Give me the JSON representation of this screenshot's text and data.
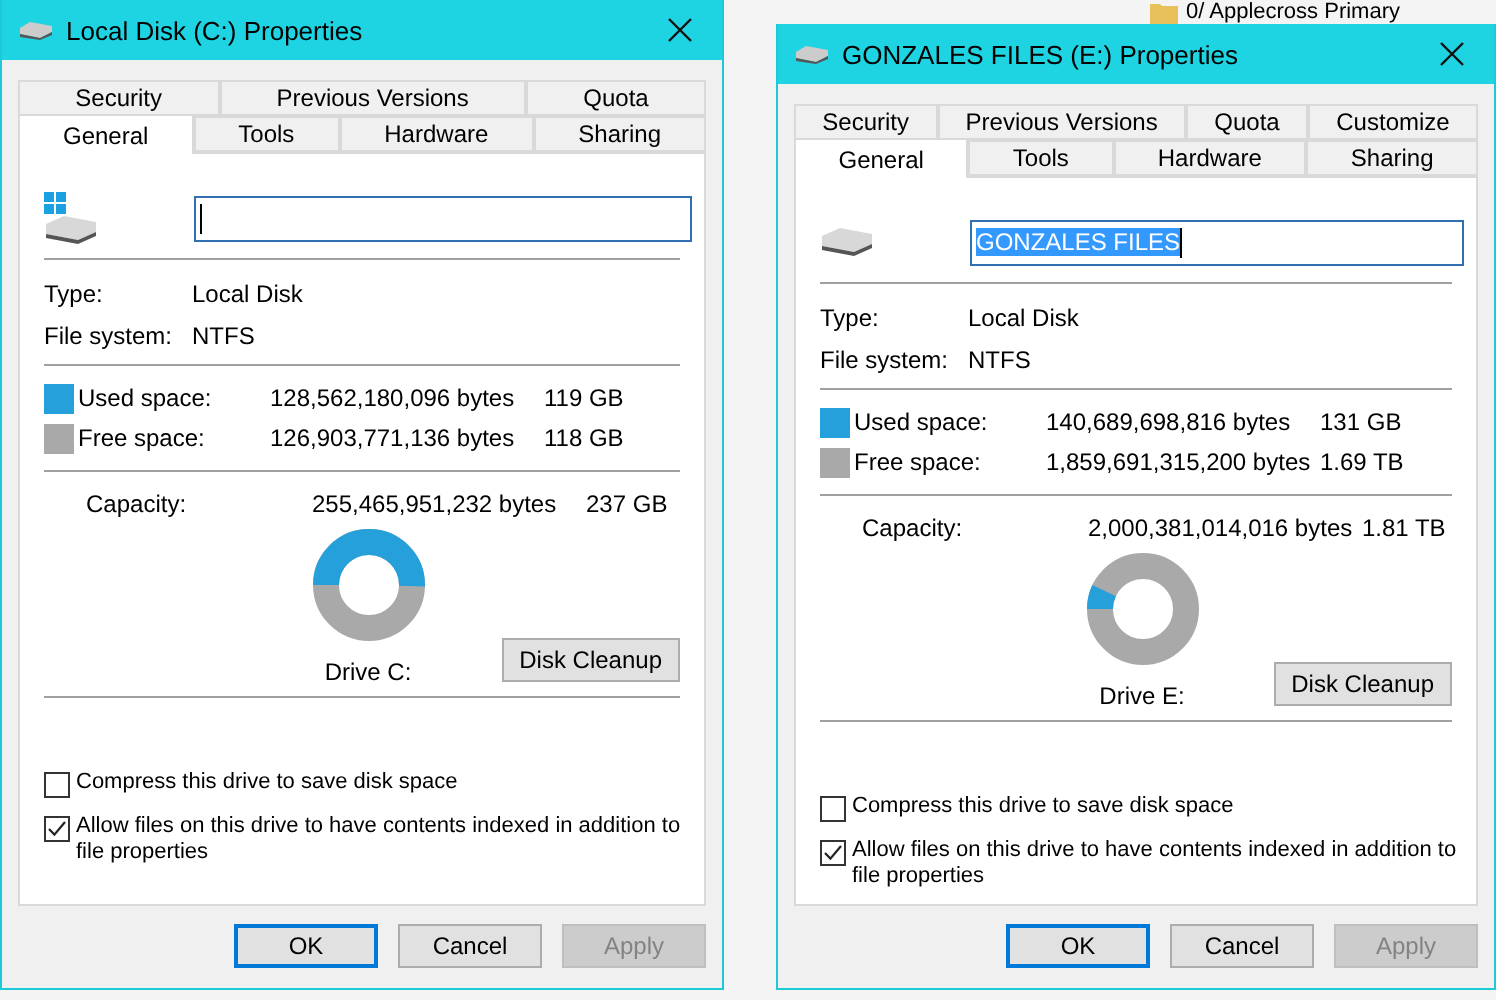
{
  "background": {
    "folder_label": "0/ Applecross Primary"
  },
  "dialogs": [
    {
      "title": "Local Disk (C:) Properties",
      "windows_badge": true,
      "tab_rows": [
        [
          {
            "label": "Security",
            "selected": false
          },
          {
            "label": "Previous Versions",
            "selected": false
          },
          {
            "label": "Quota",
            "selected": false
          }
        ],
        [
          {
            "label": "General",
            "selected": true
          },
          {
            "label": "Tools",
            "selected": false
          },
          {
            "label": "Hardware",
            "selected": false
          },
          {
            "label": "Sharing",
            "selected": false
          }
        ]
      ],
      "name_field": {
        "focused": true
      },
      "info": [
        {
          "label": "Type:",
          "value": "Local Disk"
        },
        {
          "label": "File system:",
          "value": "NTFS"
        }
      ],
      "space": [
        {
          "label": "Used space:",
          "bytes": "128,562,180,096 bytes",
          "size": "119 GB",
          "color": "#26a0da"
        },
        {
          "label": "Free space:",
          "bytes": "126,903,771,136 bytes",
          "size": "118 GB",
          "color": "#a9a9a9"
        }
      ],
      "capacity": {
        "label": "Capacity:",
        "bytes": "255,465,951,232 bytes",
        "size": "237 GB"
      },
      "drive_label": "Drive C:",
      "cleanup_button": "Disk Cleanup",
      "checkboxes": [
        {
          "label": "Compress this drive to save disk space",
          "checked": false
        },
        {
          "label": "Allow files on this drive to have contents indexed in addition to file properties",
          "checked": true
        }
      ],
      "buttons": [
        {
          "label": "OK",
          "default": true,
          "disabled": false
        },
        {
          "label": "Cancel",
          "default": false,
          "disabled": false
        },
        {
          "label": "Apply",
          "default": false,
          "disabled": true
        }
      ]
    },
    {
      "title": "GONZALES FILES (E:) Properties",
      "windows_badge": false,
      "tab_rows": [
        [
          {
            "label": "Security",
            "selected": false
          },
          {
            "label": "Previous Versions",
            "selected": false
          },
          {
            "label": "Quota",
            "selected": false
          },
          {
            "label": "Customize",
            "selected": false
          }
        ],
        [
          {
            "label": "General",
            "selected": true
          },
          {
            "label": "Tools",
            "selected": false
          },
          {
            "label": "Hardware",
            "selected": false
          },
          {
            "label": "Sharing",
            "selected": false
          }
        ]
      ],
      "name_field": {
        "value": "GONZALES FILES",
        "focused": true,
        "text_selected": true
      },
      "info": [
        {
          "label": "Type:",
          "value": "Local Disk"
        },
        {
          "label": "File system:",
          "value": "NTFS"
        }
      ],
      "space": [
        {
          "label": "Used space:",
          "bytes": "140,689,698,816 bytes",
          "size": "131 GB",
          "color": "#26a0da"
        },
        {
          "label": "Free space:",
          "bytes": "1,859,691,315,200 bytes",
          "size": "1.69 TB",
          "color": "#a9a9a9"
        }
      ],
      "capacity": {
        "label": "Capacity:",
        "bytes": "2,000,381,014,016 bytes",
        "size": "1.81 TB"
      },
      "drive_label": "Drive E:",
      "cleanup_button": "Disk Cleanup",
      "checkboxes": [
        {
          "label": "Compress this drive to save disk space",
          "checked": false
        },
        {
          "label": "Allow files on this drive to have contents indexed in addition to file properties",
          "checked": true
        }
      ],
      "buttons": [
        {
          "label": "OK",
          "default": true,
          "disabled": false
        },
        {
          "label": "Cancel",
          "default": false,
          "disabled": false
        },
        {
          "label": "Apply",
          "default": false,
          "disabled": true
        }
      ]
    }
  ]
}
